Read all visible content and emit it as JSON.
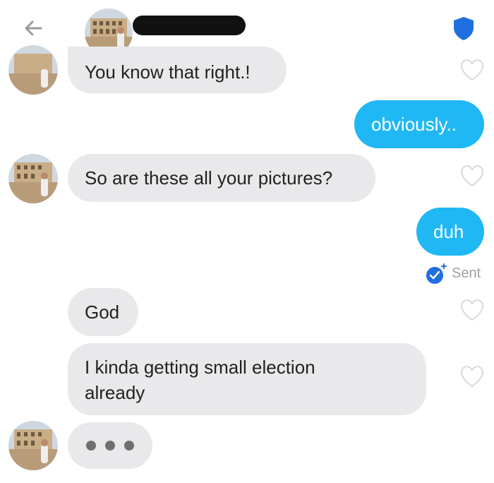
{
  "header": {
    "contact_name": "",
    "back": "back-arrow-icon",
    "safety": "shield-icon",
    "accent": "#1f6fe0"
  },
  "messages": [
    {
      "dir": "in",
      "text": "You know that right.!"
    },
    {
      "dir": "out",
      "text": "obviously.."
    },
    {
      "dir": "in",
      "text": "So are these all your pictures?"
    },
    {
      "dir": "out",
      "text": "duh"
    },
    {
      "dir": "in",
      "text": "God"
    },
    {
      "dir": "in",
      "text": "I kinda getting small election already"
    }
  ],
  "status": {
    "text": "Sent",
    "icon": "check-badge-icon"
  },
  "colors": {
    "incoming": "#e9e9eb",
    "outgoing": "#1fb8f5"
  }
}
